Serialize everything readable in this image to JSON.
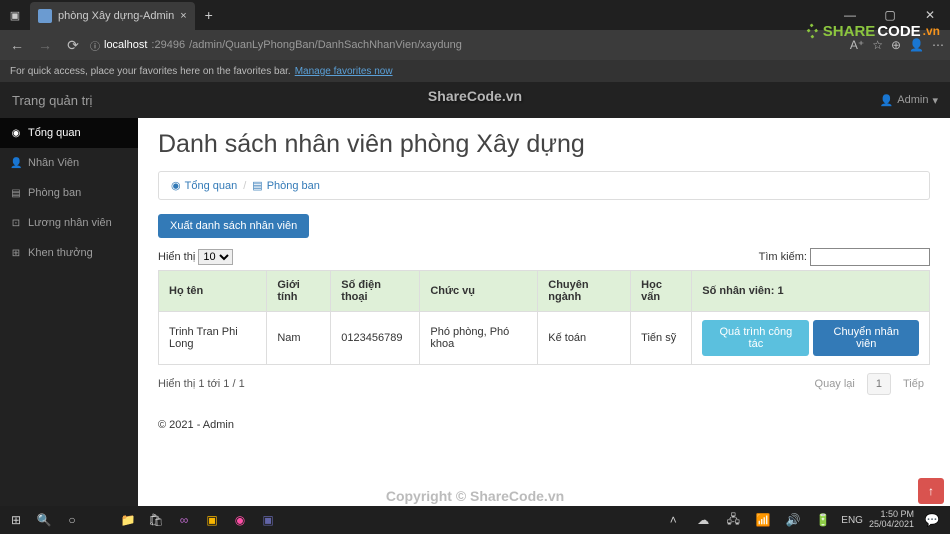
{
  "browser": {
    "tab_title": "phòng Xây dựng-Admin",
    "url_host": "localhost",
    "url_port": ":29496",
    "url_path": "/admin/QuanLyPhongBan/DanhSachNhanVien/xaydung",
    "fav_text": "For quick access, place your favorites here on the favorites bar.",
    "fav_link": "Manage favorites now"
  },
  "watermarks": {
    "top": "ShareCode.vn",
    "bottom": "Copyright © ShareCode.vn",
    "logo_a": "SHARE",
    "logo_b": "CODE",
    "logo_c": ".vn"
  },
  "app": {
    "brand": "Trang quản trị",
    "user_label": "Admin",
    "sidebar": [
      {
        "icon": "dashboard",
        "label": "Tổng quan",
        "active": true
      },
      {
        "icon": "user",
        "label": "Nhân Viên",
        "active": false
      },
      {
        "icon": "list",
        "label": "Phòng ban",
        "active": false
      },
      {
        "icon": "money",
        "label": "Lương nhân viên",
        "active": false
      },
      {
        "icon": "gift",
        "label": "Khen thưởng",
        "active": false
      }
    ]
  },
  "page": {
    "title": "Danh sách nhân viên phòng Xây dựng",
    "breadcrumb": {
      "home": "Tổng quan",
      "current": "Phòng ban",
      "sep": "/"
    },
    "export_btn": "Xuất danh sách nhân viên",
    "show_label": "Hiển thị",
    "show_value": "10",
    "search_label": "Tìm kiếm:",
    "columns": {
      "name": "Họ tên",
      "gender": "Giới tính",
      "phone": "Số điện thoại",
      "position": "Chức vụ",
      "major": "Chuyên ngành",
      "education": "Học vấn",
      "count": "Số nhân viên: 1"
    },
    "rows": [
      {
        "name": "Trinh Tran Phi Long",
        "gender": "Nam",
        "phone": "0123456789",
        "position": "Phó phòng, Phó khoa",
        "major": "Kế toán",
        "education": "Tiến sỹ",
        "btn1": "Quá trình công tác",
        "btn2": "Chuyển nhân viên"
      }
    ],
    "info": "Hiển thị 1 tới 1 / 1",
    "prev": "Quay lại",
    "page": "1",
    "next": "Tiếp",
    "footer": "© 2021 - Admin"
  },
  "taskbar": {
    "lang": "ENG",
    "time": "1:50 PM",
    "date": "25/04/2021"
  }
}
